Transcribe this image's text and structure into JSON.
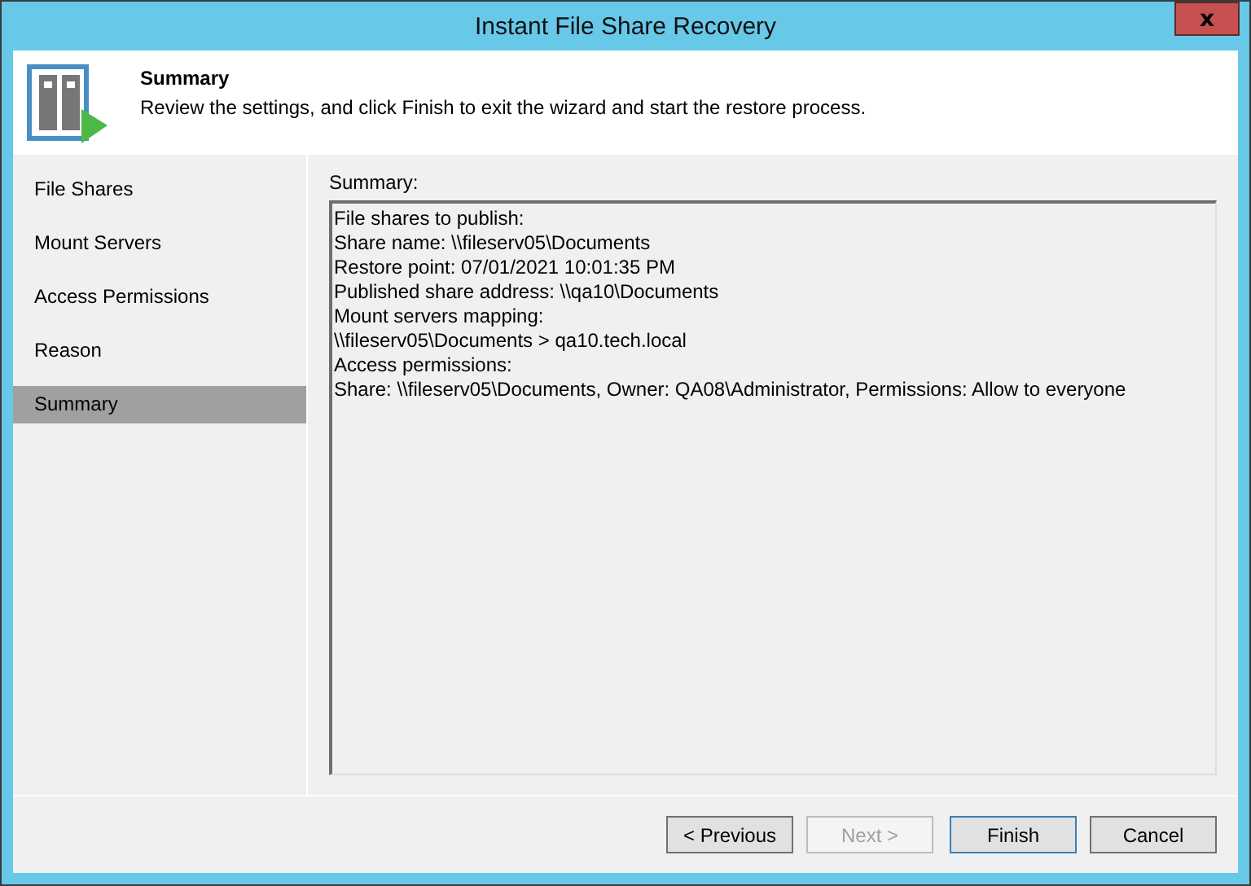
{
  "window": {
    "title": "Instant File Share Recovery",
    "close": "x"
  },
  "header": {
    "title": "Summary",
    "description": "Review the settings, and click Finish to exit the wizard and start the restore process."
  },
  "steps": [
    {
      "label": "File Shares",
      "selected": false
    },
    {
      "label": "Mount Servers",
      "selected": false
    },
    {
      "label": "Access Permissions",
      "selected": false
    },
    {
      "label": "Reason",
      "selected": false
    },
    {
      "label": "Summary",
      "selected": true
    }
  ],
  "summary": {
    "label": "Summary:",
    "lines": [
      "File shares to publish:",
      "Share name: \\\\fileserv05\\Documents",
      "Restore point: 07/01/2021 10:01:35 PM",
      "Published share address: \\\\qa10\\Documents",
      "Mount servers mapping:",
      "\\\\fileserv05\\Documents > qa10.tech.local",
      "Access permissions:",
      "Share: \\\\fileserv05\\Documents, Owner: QA08\\Administrator, Permissions: Allow to everyone"
    ]
  },
  "buttons": [
    {
      "label": "< Previous",
      "disabled": false,
      "default": false
    },
    {
      "label": "Next >",
      "disabled": true,
      "default": false
    },
    {
      "label": "Finish",
      "disabled": false,
      "default": true
    },
    {
      "label": "Cancel",
      "disabled": false,
      "default": false
    }
  ]
}
